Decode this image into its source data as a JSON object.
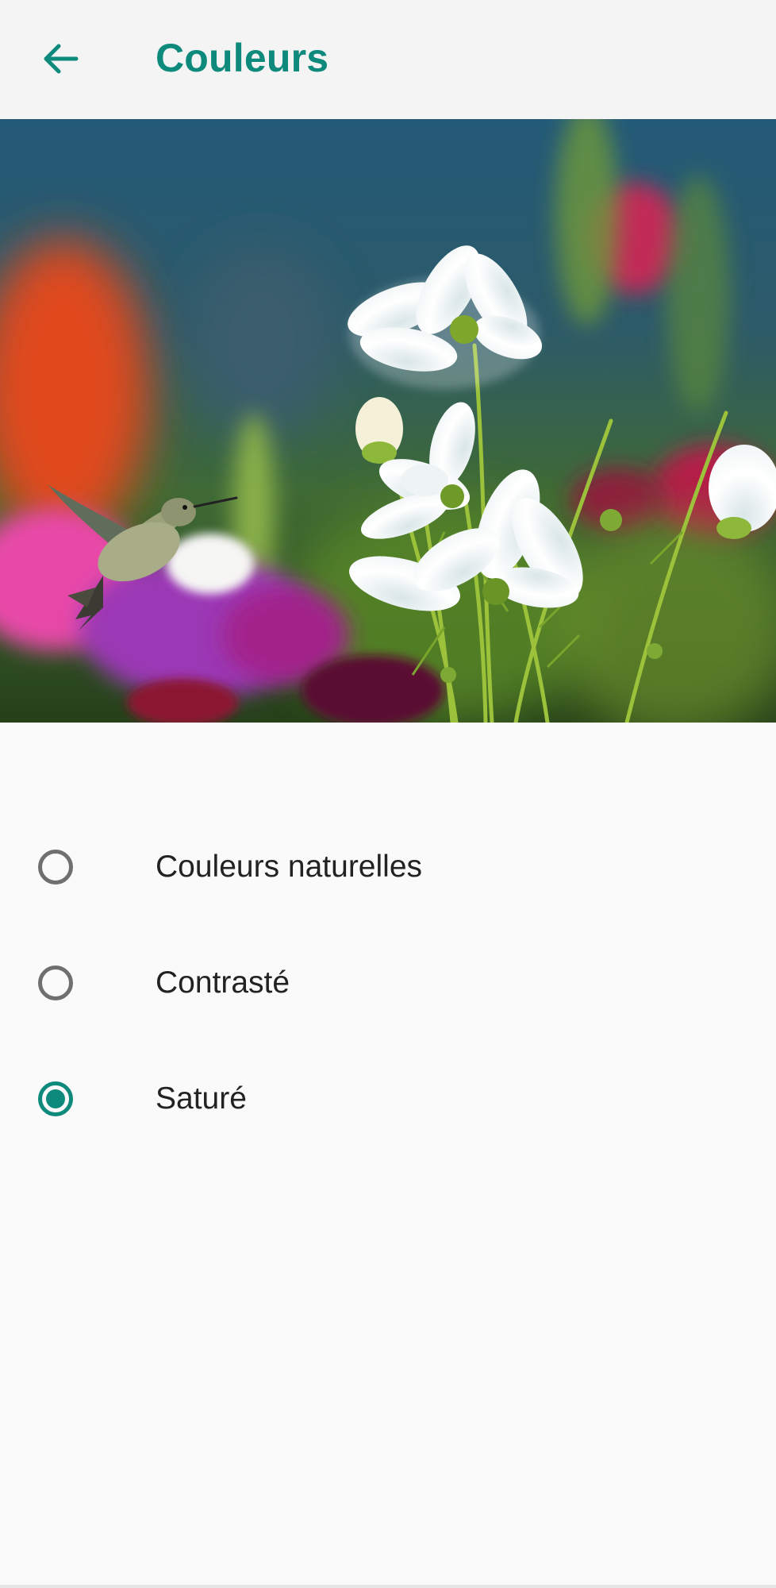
{
  "appbar": {
    "title": "Couleurs",
    "back_icon": "arrow-left-icon",
    "accent_color": "#0d8a7b"
  },
  "preview": {
    "subject": "hummingbird-and-cosmos-flowers-photo"
  },
  "color_modes": {
    "selected_index": 2,
    "options": [
      {
        "label": "Couleurs naturelles",
        "selected": false
      },
      {
        "label": "Contrasté",
        "selected": false
      },
      {
        "label": "Saturé",
        "selected": true
      }
    ]
  }
}
